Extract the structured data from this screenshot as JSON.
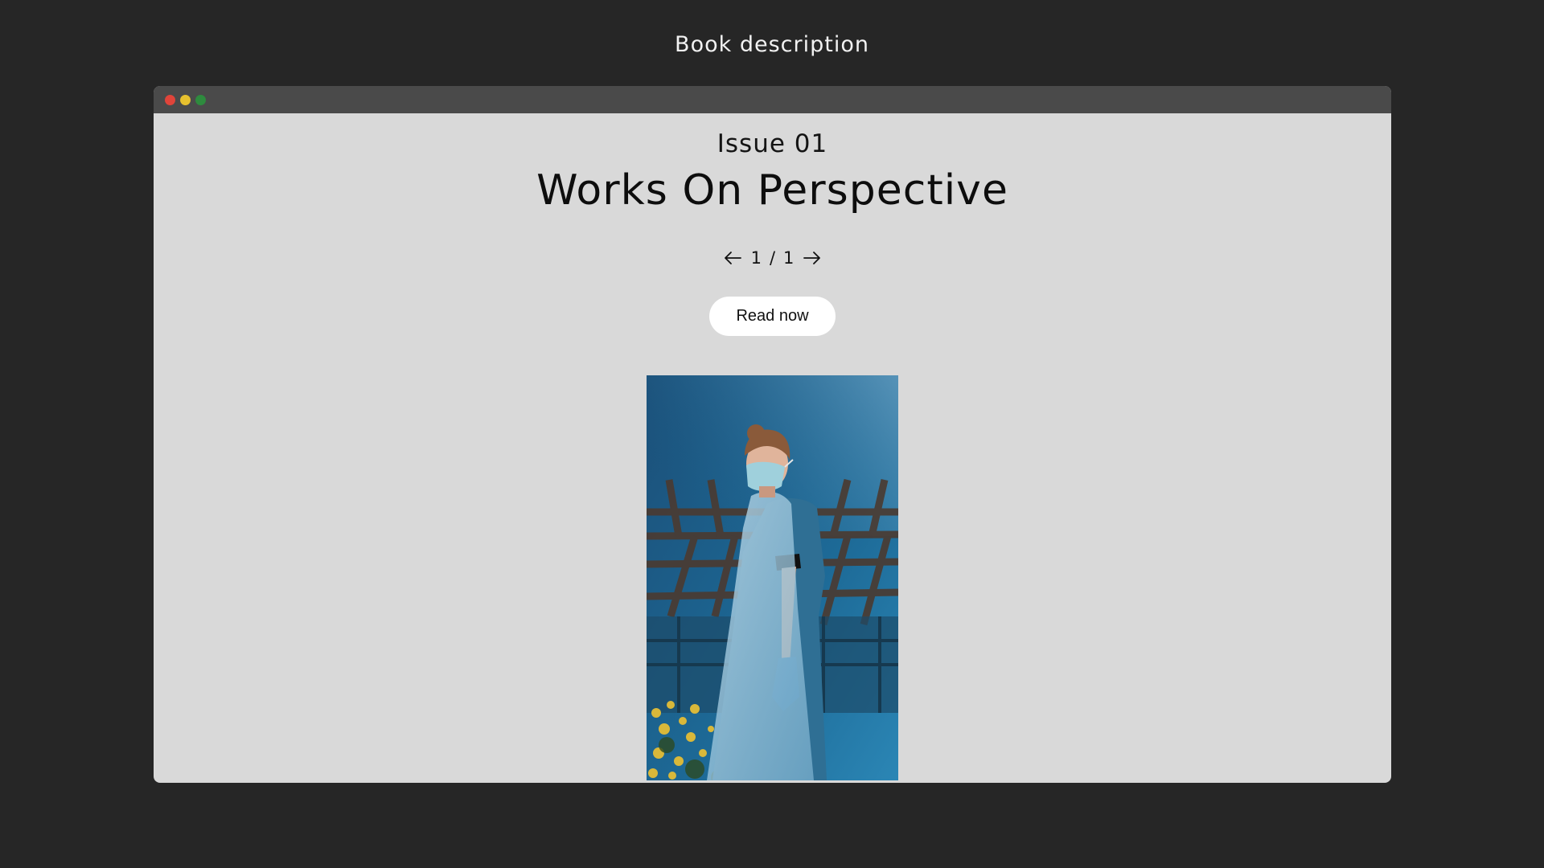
{
  "page": {
    "caption": "Book description"
  },
  "window": {
    "controls": {
      "close_color": "#e0443a",
      "minimize_color": "#e6c02e",
      "maximize_color": "#2e8b3e"
    }
  },
  "book": {
    "issue": "Issue 01",
    "title": "Works On Perspective",
    "pager": {
      "current": "1",
      "separator": "/",
      "total": "1",
      "prev_icon": "arrow-left-icon",
      "next_icon": "arrow-right-icon"
    },
    "read_button_label": "Read now",
    "cover_image": "nurse-in-mask-and-apron-photo"
  },
  "colors": {
    "background": "#262626",
    "titlebar": "#4a4a4a",
    "content_bg": "#d9d9d9",
    "button_bg": "#ffffff"
  }
}
